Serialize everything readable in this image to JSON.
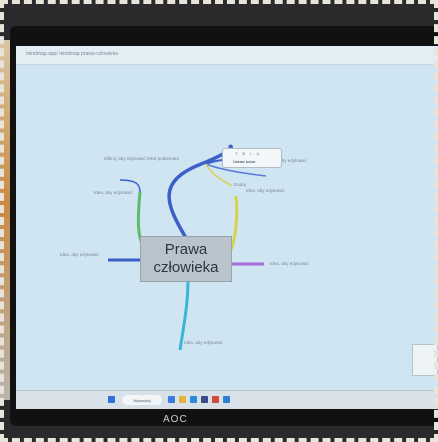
{
  "browser": {
    "url_text": "mindmap.app/ mindmap prawa-czlowieka"
  },
  "central_topic": {
    "line1": "Prawa",
    "line2": "człowieka"
  },
  "branch_labels": [
    "Idea, aby edytować",
    "Idea, aby edytować",
    "Idea, aby edytować",
    "Idea, aby edytować",
    "Idea, aby edytować",
    "Idea, aby edytować",
    "Dodaj",
    "Kliknij, aby edytować tekst podtematu"
  ],
  "popup": {
    "icons": "T B I U",
    "sub_label": "Ustaw kolor"
  },
  "taskbar": {
    "search_label": "Wyszukaj"
  },
  "monitor_brand": "AOC",
  "colors": {
    "branch_blue": "#3d5fc9",
    "branch_green": "#5bbf6a",
    "branch_yellow": "#d7d24e",
    "branch_purple": "#a76ddc",
    "branch_cyan": "#37b7d5",
    "screen_bg": "#cfe6f2"
  }
}
